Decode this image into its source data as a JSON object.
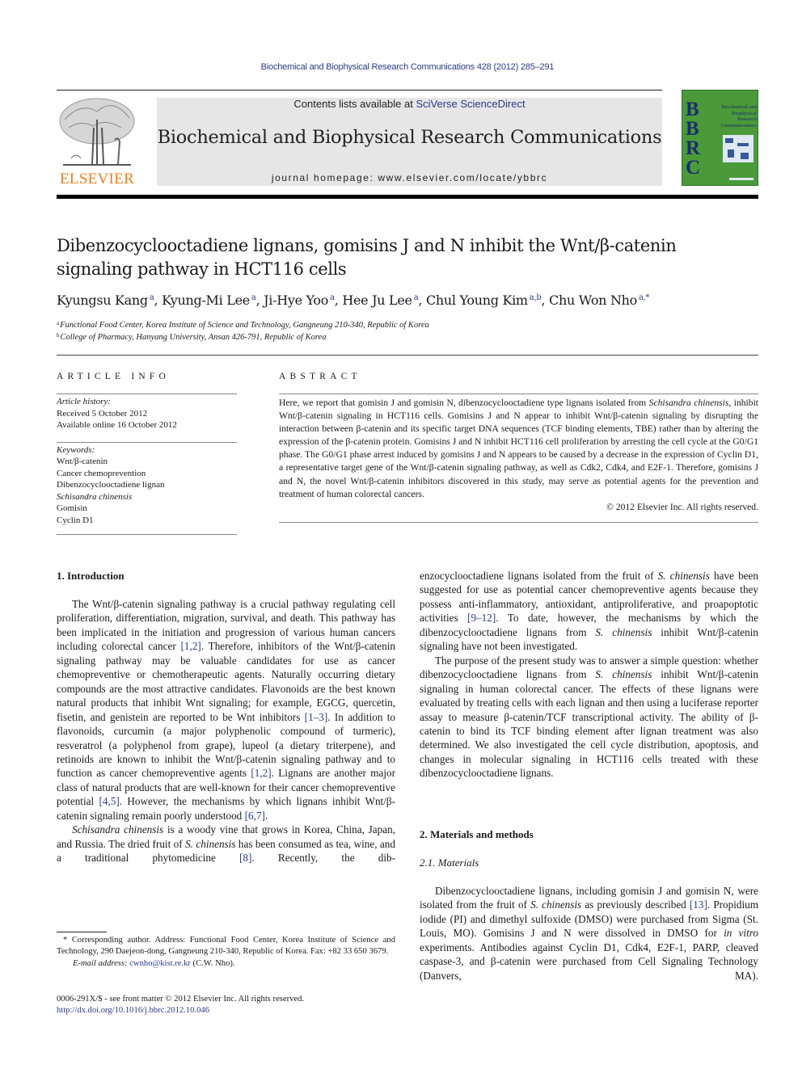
{
  "header": {
    "citation": "Biochemical and Biophysical Research Communications 428 (2012) 285–291",
    "contents_prefix": "Contents lists available at ",
    "contents_link": "SciVerse ScienceDirect",
    "journal_title": "Biochemical and Biophysical Research Communications",
    "homepage_prefix": "journal homepage: ",
    "homepage_url": "www.elsevier.com/locate/ybbrc",
    "publisher_logo_text": "ELSEVIER",
    "cover": {
      "letters": [
        "B",
        "B",
        "R",
        "C"
      ],
      "title_lines": [
        "Biochemical and",
        "Biophysical",
        "Research",
        "Communications"
      ],
      "color": "#4a9a3a"
    }
  },
  "article": {
    "title_line1": "Dibenzocyclooctadiene lignans, gomisins J and N inhibit the Wnt/β-catenin",
    "title_line2": "signaling pathway in HCT116 cells",
    "authors": [
      {
        "name": "Kyungsu Kang",
        "sup": "a"
      },
      {
        "name": "Kyung-Mi Lee",
        "sup": "a"
      },
      {
        "name": "Ji-Hye Yoo",
        "sup": "a"
      },
      {
        "name": "Hee Ju Lee",
        "sup": "a"
      },
      {
        "name": "Chul Young Kim",
        "sup": "a,b"
      },
      {
        "name": "Chu Won Nho",
        "sup": "a,*"
      }
    ],
    "affiliations": [
      {
        "mark": "a",
        "text": "Functional Food Center, Korea Institute of Science and Technology, Gangneung 210-340, Republic of Korea"
      },
      {
        "mark": "b",
        "text": "College of Pharmacy, Hanyang University, Ansan 426-791, Republic of Korea"
      }
    ]
  },
  "article_info": {
    "heading": "ARTICLE INFO",
    "history_label": "Article history:",
    "received": "Received 5 October 2012",
    "available": "Available online 16 October 2012",
    "keywords_label": "Keywords:",
    "keywords": [
      "Wnt/β-catenin",
      "Cancer chemoprevention",
      "Dibenzocyclooctadiene lignan",
      "Schisandra chinensis",
      "Gomisin",
      "Cyclin D1"
    ]
  },
  "abstract": {
    "heading": "ABSTRACT",
    "p1_a": "Here, we report that gomisin J and gomisin N, dibenzocyclooctadiene type lignans isolated from ",
    "p1_species": "Schisandra chinensis",
    "p1_b": ", inhibit Wnt/β-catenin signaling in HCT116 cells. Gomisins J and N appear to inhibit Wnt/β-catenin signaling by disrupting the interaction between β-catenin and its specific target DNA sequences (TCF binding elements, TBE) rather than by altering the expression of the β-catenin protein. Gomisins J and N inhibit HCT116 cell proliferation by arresting the cell cycle at the G0/G1 phase. The G0/G1 phase arrest induced by gomisins J and N appears to be caused by a decrease in the expression of Cyclin D1, a representative target gene of the Wnt/β-catenin signaling pathway, as well as Cdk2, Cdk4, and E2F-1. Therefore, gomisins J and N, the novel Wnt/β-catenin inhibitors discovered in this study, may serve as potential agents for the prevention and treatment of human colorectal cancers.",
    "copyright": "© 2012 Elsevier Inc. All rights reserved."
  },
  "intro": {
    "heading": "1. Introduction",
    "p1_a": "The Wnt/β-catenin signaling pathway is a crucial pathway regulating cell proliferation, differentiation, migration, survival, and death. This pathway has been implicated in the initiation and progression of various human cancers including colorectal cancer ",
    "ref1": "[1,2]",
    "p1_b": ". Therefore, inhibitors of the Wnt/β-catenin signaling pathway may be valuable candidates for use as cancer chemopreventive or chemotherapeutic agents. Naturally occurring dietary compounds are the most attractive candidates. Flavonoids are the best known natural products that inhibit Wnt signaling; for example, EGCG, quercetin, fisetin, and genistein are reported to be Wnt inhibitors ",
    "ref2": "[1–3]",
    "p1_c": ". In addition to flavonoids, curcumin (a major polyphenolic compound of turmeric), resveratrol (a polyphenol from grape), lupeol (a dietary triterpene), and retinoids are known to inhibit the Wnt/β-catenin signaling pathway and to function as cancer chemopreventive agents ",
    "ref3": "[1,2]",
    "p1_d": ". Lignans are another major class of natural products that are well-known for their cancer chemopreventive potential ",
    "ref4": "[4,5]",
    "p1_e": ". However, the mechanisms by which lignans inhibit Wnt/β-catenin signaling remain poorly understood ",
    "ref5": "[6,7]",
    "p1_f": ".",
    "p2_species": "Schisandra chinensis",
    "p2_a": " is a woody vine that grows in Korea, China, Japan, and Russia. The dried fruit of ",
    "p2_species2": "S. chinensis",
    "p2_b": " has been consumed as tea, wine, and a traditional phytomedicine ",
    "ref6": "[8]",
    "p2_c": ". Recently, the dib-",
    "col2_p2_a": "enzocyclooctadiene lignans isolated from the fruit of ",
    "col2_species": "S. chinensis",
    "col2_p2_b": " have been suggested for use as potential cancer chemopreventive agents because they possess anti-inflammatory, antioxidant, antiproliferative, and proapoptotic activities ",
    "ref7": "[9–12]",
    "col2_p2_c": ". To date, however, the mechanisms by which the dibenzocyclooctadiene lignans from ",
    "col2_species2": "S. chinensis",
    "col2_p2_d": " inhibit Wnt/β-catenin signaling have not been investigated.",
    "p3_a": "The purpose of the present study was to answer a simple question: whether dibenzocyclooctadiene lignans from ",
    "p3_species": "S. chinensis",
    "p3_b": " inhibit Wnt/β-catenin signaling in human colorectal cancer. The effects of these lignans were evaluated by treating cells with each lignan and then using a luciferase reporter assay to measure β-catenin/TCF transcriptional activity. The ability of β-catenin to bind its TCF binding element after lignan treatment was also determined. We also investigated the cell cycle distribution, apoptosis, and changes in molecular signaling in HCT116 cells treated with these dibenzocyclooctadiene lignans."
  },
  "methods": {
    "heading": "2. Materials and methods",
    "sub_heading": "2.1. Materials",
    "p1_a": "Dibenzocyclooctadiene lignans, including gomisin J and gomisin N, were isolated from the fruit of ",
    "p1_species": "S. chinensis",
    "p1_b": " as previously described ",
    "ref1": "[13]",
    "p1_c": ". Propidium iodide (PI) and dimethyl sulfoxide (DMSO) were purchased from Sigma (St. Louis, MO). Gomisins J and N were dissolved in DMSO for ",
    "p1_invitro": "in vitro",
    "p1_d": " experiments. Antibodies against Cyclin D1, Cdk4, E2F-1, PARP, cleaved caspase-3, and β-catenin were purchased from Cell Signaling Technology (Danvers, MA)."
  },
  "footnotes": {
    "corresponding": "* Corresponding author. Address: Functional Food Center, Korea Institute of Science and Technology, 290 Daejeon-dong, Gangneung 210-340, Republic of Korea. Fax: +82 33 650 3679.",
    "email_label": "E-mail address: ",
    "email": "cwnho@kist.re.kr",
    "email_suffix": " (C.W. Nho).",
    "issn": "0006-291X/$ - see front matter © 2012 Elsevier Inc. All rights reserved.",
    "doi": "http://dx.doi.org/10.1016/j.bbrc.2012.10.046"
  }
}
